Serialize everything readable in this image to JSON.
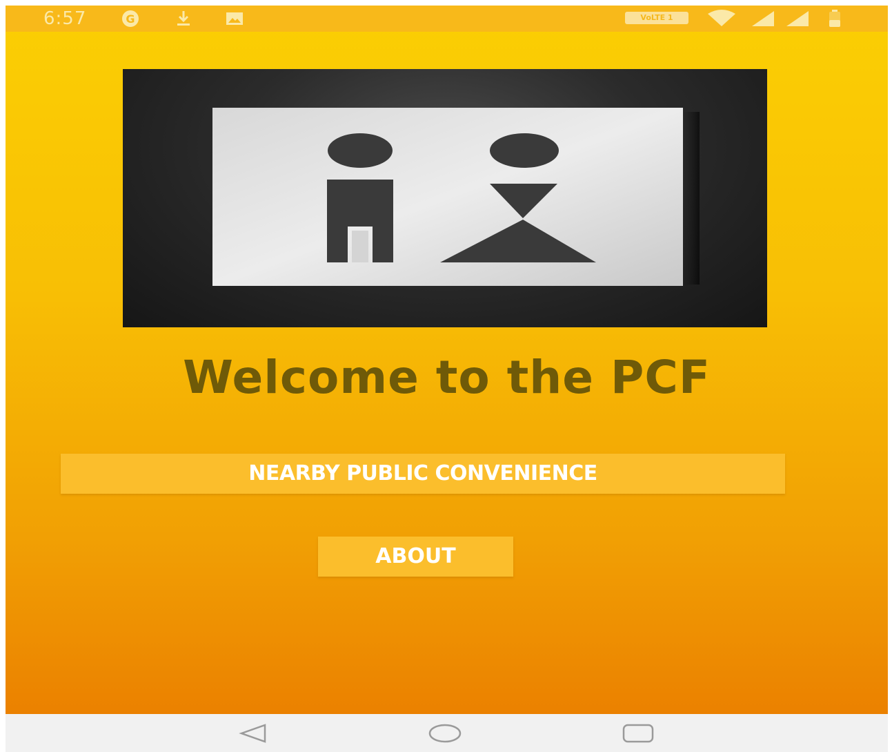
{
  "status_bar": {
    "time": "6:57",
    "network_badge": "VoLTE 1",
    "left_icons": [
      "google-icon",
      "download-icon",
      "image-icon"
    ],
    "right_icons": [
      "wifi-icon",
      "signal-icon",
      "signal-icon",
      "battery-icon"
    ]
  },
  "main": {
    "title": "Welcome to the PCF",
    "nearby_button_label": "NEARBY PUBLIC CONVENIENCE",
    "about_button_label": "ABOUT"
  },
  "nav_bar": {
    "items": [
      "back-icon",
      "home-icon",
      "recents-icon"
    ]
  },
  "colors": {
    "gradient_top": "#fbcf03",
    "gradient_bottom": "#eb8100",
    "button_bg": "#fbbe2c",
    "title_color": "#6f5a08"
  }
}
